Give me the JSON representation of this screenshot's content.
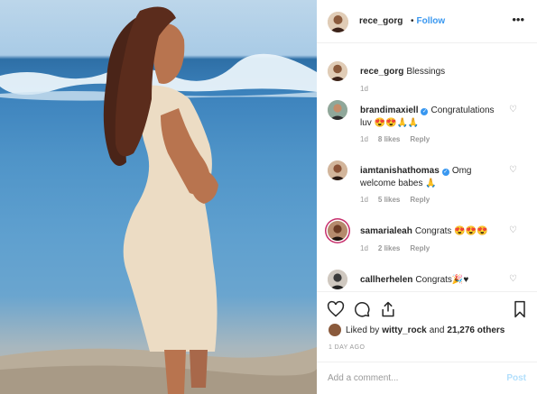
{
  "post": {
    "author": "rece_gorg",
    "follow_label": "Follow",
    "more_icon": "more-dots-icon"
  },
  "comments": [
    {
      "user": "rece_gorg",
      "text": "Blessings",
      "verified": false,
      "time": "1d",
      "likes": "",
      "reply": ""
    },
    {
      "user": "brandimaxiell",
      "text": "Congratulations luv 😍😍🙏🙏",
      "verified": true,
      "time": "1d",
      "likes": "8 likes",
      "reply": "Reply"
    },
    {
      "user": "iamtanishathomas",
      "text": "Omg welcome babes 🙏",
      "verified": true,
      "time": "1d",
      "likes": "5 likes",
      "reply": "Reply"
    },
    {
      "user": "samarialeah",
      "text": "Congrats 😍😍😍",
      "verified": false,
      "time": "1d",
      "likes": "2 likes",
      "reply": "Reply"
    },
    {
      "user": "callherhelen",
      "text": "Congrats🎉♥",
      "verified": false,
      "time": "",
      "likes": "",
      "reply": ""
    }
  ],
  "likes": {
    "prefix": "Liked by",
    "user": "witty_rock",
    "and": "and",
    "count": "21,276 others"
  },
  "date": "1 DAY AGO",
  "add_comment": {
    "placeholder": "Add a comment...",
    "post_label": "Post"
  },
  "colors": {
    "link": "#3897f0",
    "muted": "#999999",
    "story_ring": "#c72f6c"
  }
}
